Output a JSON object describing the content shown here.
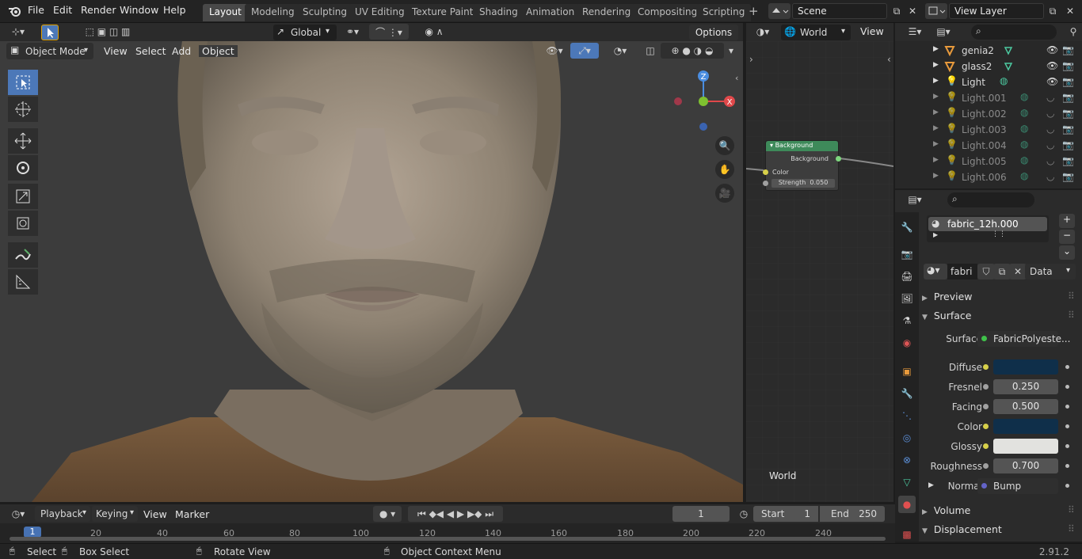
{
  "menu": {
    "file": "File",
    "edit": "Edit",
    "render": "Render",
    "window": "Window",
    "help": "Help"
  },
  "workspaces": [
    "Layout",
    "Modeling",
    "Sculpting",
    "UV Editing",
    "Texture Paint",
    "Shading",
    "Animation",
    "Rendering",
    "Compositing",
    "Scripting"
  ],
  "scene": {
    "label": "Scene"
  },
  "view_layer": {
    "label": "View Layer"
  },
  "viewport_header": {
    "transform_orientation": "Global",
    "options": "Options",
    "mode": "Object Mode",
    "menu_view": "View",
    "menu_select": "Select",
    "menu_add": "Add",
    "menu_object": "Object"
  },
  "gizmo": {
    "z": "Z",
    "x": "X"
  },
  "node_header": {
    "world_label": "World",
    "view": "View"
  },
  "node": {
    "title": "Background",
    "output": "Background",
    "input_color": "Color",
    "strength_label": "Strength",
    "strength_value": "0.050"
  },
  "node_footer": {
    "world": "World"
  },
  "outliner": {
    "items": [
      {
        "name": "genia2",
        "type": "mesh"
      },
      {
        "name": "glass2",
        "type": "mesh"
      },
      {
        "name": "Light",
        "type": "light"
      },
      {
        "name": "Light.001",
        "type": "light"
      },
      {
        "name": "Light.002",
        "type": "light"
      },
      {
        "name": "Light.003",
        "type": "light"
      },
      {
        "name": "Light.004",
        "type": "light"
      },
      {
        "name": "Light.005",
        "type": "light"
      },
      {
        "name": "Light.006",
        "type": "light"
      }
    ]
  },
  "properties": {
    "material_slot": "fabric_12h.000",
    "material_name": "fabri",
    "link": "Data",
    "preview": "Preview",
    "surface_section": "Surface",
    "surface_label": "Surface",
    "surface_value": "FabricPolyeste...",
    "rows": [
      {
        "label": "Diffuse",
        "value": "",
        "type": "color",
        "color": "#0f2f4a"
      },
      {
        "label": "Fresnel",
        "value": "0.250",
        "type": "number"
      },
      {
        "label": "Facing",
        "value": "0.500",
        "type": "number"
      },
      {
        "label": "Color",
        "value": "",
        "type": "color",
        "color": "#0f2f4a"
      },
      {
        "label": "Glossy",
        "value": "",
        "type": "color",
        "color": "#e2e2df"
      },
      {
        "label": "Roughness",
        "value": "0.700",
        "type": "number"
      }
    ],
    "normal_label": "Normal",
    "normal_value": "Bump",
    "volume": "Volume",
    "displacement": "Displacement"
  },
  "timeline": {
    "playback": "Playback",
    "keying": "Keying",
    "view": "View",
    "marker": "Marker",
    "current_frame": "1",
    "start_label": "Start",
    "start_value": "1",
    "end_label": "End",
    "end_value": "250",
    "ticks": [
      "1",
      "20",
      "40",
      "60",
      "80",
      "100",
      "120",
      "140",
      "160",
      "180",
      "200",
      "220",
      "240"
    ]
  },
  "status": {
    "select": "Select",
    "box_select": "Box Select",
    "rotate_view": "Rotate View",
    "context_menu": "Object Context Menu",
    "version": "2.91.2"
  }
}
